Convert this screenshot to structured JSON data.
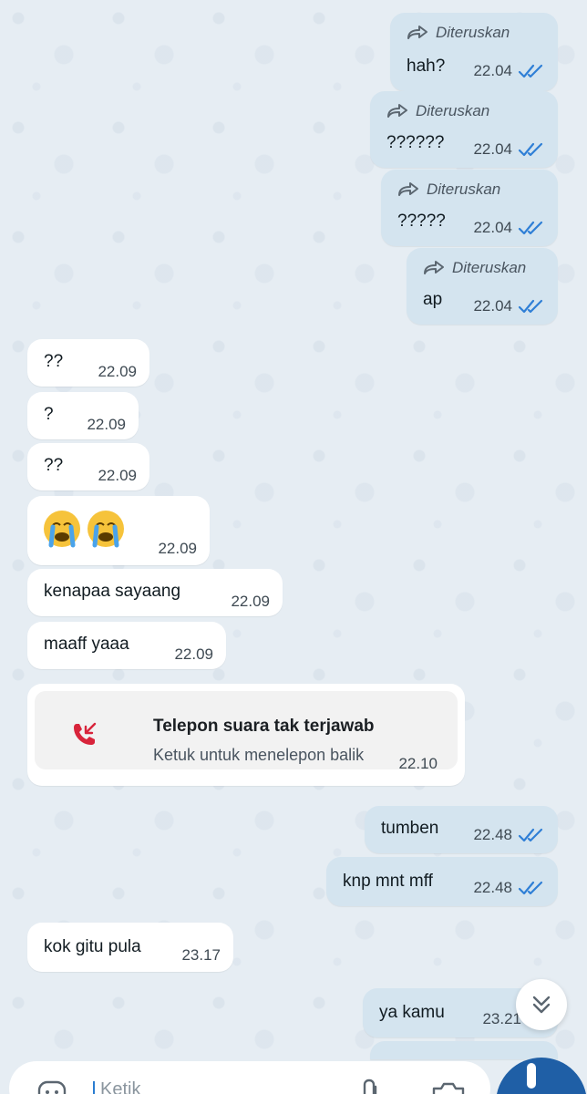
{
  "chat": {
    "forwarded_label": "Diteruskan",
    "messages": [
      {
        "text": "hah?",
        "time": "22.04"
      },
      {
        "text": "??????",
        "time": "22.04"
      },
      {
        "text": "?????",
        "time": "22.04"
      },
      {
        "text": "ap",
        "time": "22.04"
      },
      {
        "text": "??",
        "time": "22.09"
      },
      {
        "text": "?",
        "time": "22.09"
      },
      {
        "text": "??",
        "time": "22.09"
      },
      {
        "text": "😭😭",
        "time": "22.09"
      },
      {
        "text": "kenapaa sayaang",
        "time": "22.09"
      },
      {
        "text": "maaff yaaa",
        "time": "22.09"
      },
      {
        "text": "tumben",
        "time": "22.48"
      },
      {
        "text": "knp mnt mff",
        "time": "22.48"
      },
      {
        "text": "kok gitu pula",
        "time": "23.17"
      },
      {
        "text": "ya kamu",
        "time": "23.21"
      }
    ],
    "missed_call": {
      "title": "Telepon suara tak terjawab",
      "subtitle": "Ketuk untuk menelepon balik",
      "time": "22.10"
    }
  },
  "composer": {
    "placeholder": "Ketik"
  },
  "colors": {
    "outgoing_bubble": "#d4e4ef",
    "incoming_bubble": "#ffffff",
    "read_ticks": "#2f7fd6",
    "missed_call_red": "#d8243b",
    "mic_button": "#1f5fa6"
  },
  "icons": [
    "forward-arrow-icon",
    "double-check-icon",
    "missed-call-icon",
    "chevron-double-down-icon",
    "emoji-icon",
    "attach-icon",
    "camera-icon",
    "mic-icon"
  ]
}
